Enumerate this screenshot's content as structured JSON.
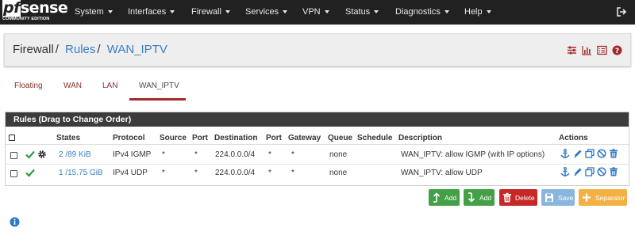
{
  "brand": {
    "logo_text_pf": "pf",
    "logo_text_sense": "sense",
    "edition": "COMMUNITY EDITION"
  },
  "nav": {
    "items": [
      {
        "label": "System"
      },
      {
        "label": "Interfaces"
      },
      {
        "label": "Firewall"
      },
      {
        "label": "Services"
      },
      {
        "label": "VPN"
      },
      {
        "label": "Status"
      },
      {
        "label": "Diagnostics"
      },
      {
        "label": "Help"
      }
    ],
    "logout_icon": "sign-out-icon"
  },
  "breadcrumb": {
    "items": [
      "Firewall",
      "Rules",
      "WAN_IPTV"
    ],
    "separator": "/",
    "icons": [
      "sliders-icon",
      "bar-chart-icon",
      "list-alt-icon",
      "question-circle-icon"
    ]
  },
  "tabs": [
    {
      "label": "Floating",
      "active": false
    },
    {
      "label": "WAN",
      "active": false
    },
    {
      "label": "LAN",
      "active": false
    },
    {
      "label": "WAN_IPTV",
      "active": true
    }
  ],
  "rules": {
    "panel_title": "Rules (Drag to Change Order)",
    "columns": [
      "States",
      "Protocol",
      "Source",
      "Port",
      "Destination",
      "Port",
      "Gateway",
      "Queue",
      "Schedule",
      "Description",
      "Actions"
    ],
    "rows": [
      {
        "states": "2 /89 KiB",
        "protocol": "IPv4 IGMP",
        "source": "*",
        "source_port": "*",
        "destination": "224.0.0.0/4",
        "destination_port": "*",
        "gateway": "*",
        "queue": "none",
        "schedule": "",
        "description": "WAN_IPTV: allow IGMP (with IP options)",
        "has_advanced": true
      },
      {
        "states": "1 /15.75 GiB",
        "protocol": "IPv4 UDP",
        "source": "*",
        "source_port": "*",
        "destination": "224.0.0.0/4",
        "destination_port": "*",
        "gateway": "*",
        "queue": "none",
        "schedule": "",
        "description": "WAN_IPTV: allow UDP",
        "has_advanced": false
      }
    ],
    "row_action_icons": [
      "anchor-icon",
      "pencil-icon",
      "copy-icon",
      "ban-icon",
      "trash-icon"
    ]
  },
  "buttons": {
    "add_top": "Add",
    "add_bottom": "Add",
    "delete": "Delete",
    "save": "Save",
    "separator": "Separator"
  },
  "colors": {
    "navbar": "#212121",
    "link": "#3b7fc2",
    "tab_link": "#8b2e2e",
    "tab_active_underline": "#a52a2a",
    "pass_green": "#2e9b3e",
    "action_blue": "#2f78c4",
    "btn_green": "#43a047",
    "btn_red": "#c62828",
    "btn_blue": "#8ab5de",
    "btn_orange": "#f4b143"
  }
}
